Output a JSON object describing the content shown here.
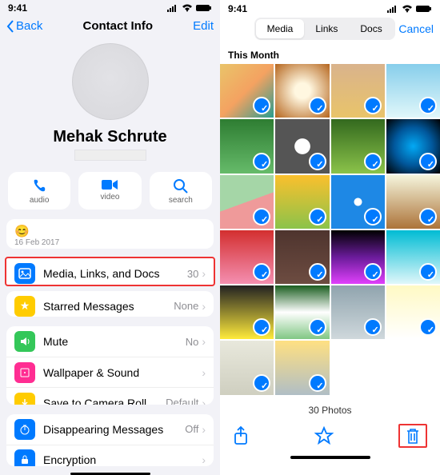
{
  "left": {
    "time": "9:41",
    "nav": {
      "back": "Back",
      "title": "Contact Info",
      "edit": "Edit"
    },
    "contact_name": "Mehak Schrute",
    "communications": [
      {
        "label": "audio"
      },
      {
        "label": "video"
      },
      {
        "label": "search"
      }
    ],
    "status": {
      "emoji": "😊",
      "date": "16 Feb 2017"
    },
    "media_row": {
      "label": "Media, Links, and Docs",
      "value": "30"
    },
    "starred_row": {
      "label": "Starred Messages",
      "value": "None"
    },
    "settings": [
      {
        "label": "Mute",
        "value": "No"
      },
      {
        "label": "Wallpaper & Sound",
        "value": ""
      },
      {
        "label": "Save to Camera Roll",
        "value": "Default"
      }
    ],
    "privacy": [
      {
        "label": "Disappearing Messages",
        "value": "Off"
      },
      {
        "label": "Encryption",
        "value": ""
      }
    ]
  },
  "right": {
    "time": "9:41",
    "tabs": {
      "media": "Media",
      "links": "Links",
      "docs": "Docs"
    },
    "cancel": "Cancel",
    "section": "This Month",
    "count": "30 Photos"
  }
}
